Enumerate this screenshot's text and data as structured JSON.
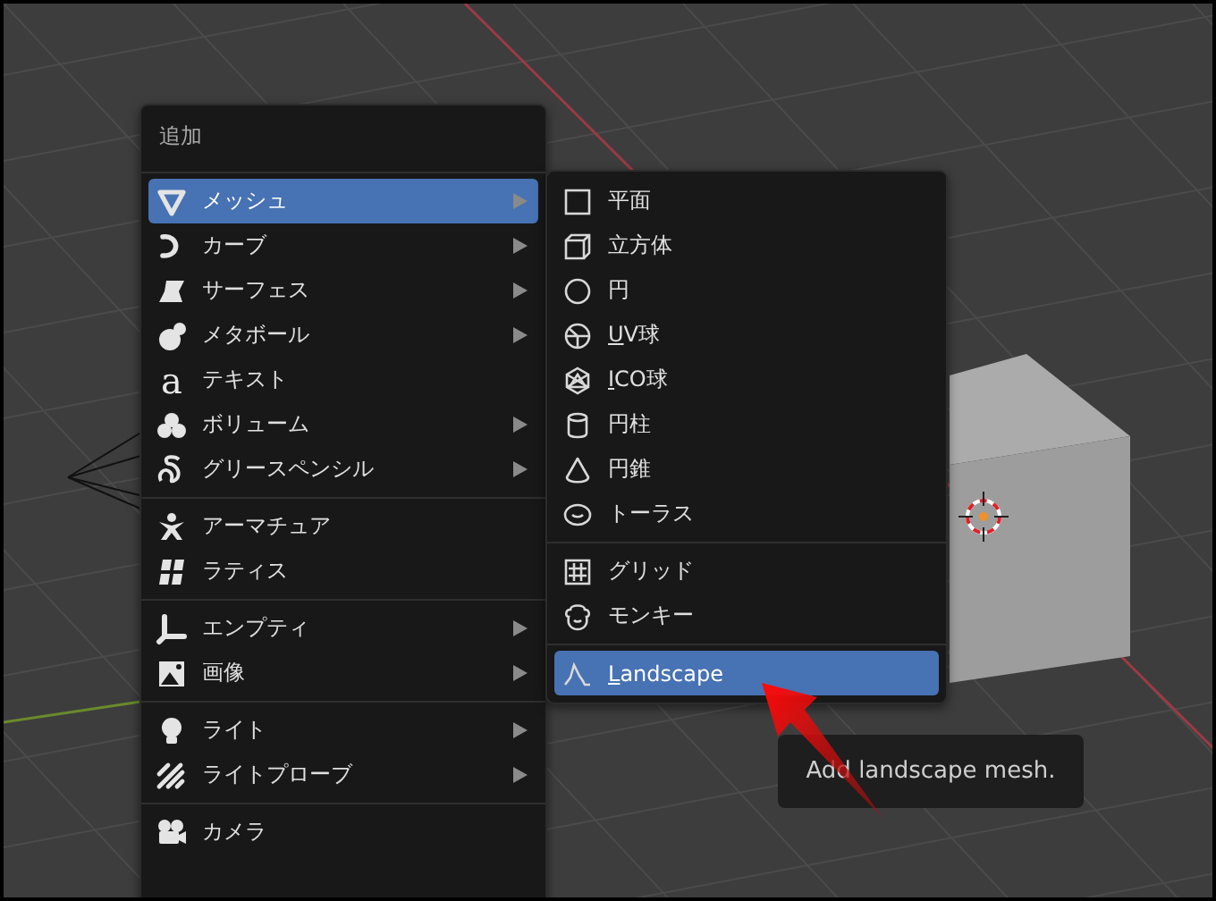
{
  "add_menu": {
    "title": "追加",
    "sections": [
      [
        {
          "label": "メッシュ",
          "selected": true,
          "has_submenu": true
        },
        {
          "label": "カーブ",
          "selected": false,
          "has_submenu": true
        },
        {
          "label": "サーフェス",
          "selected": false,
          "has_submenu": true
        },
        {
          "label": "メタボール",
          "selected": false,
          "has_submenu": true
        },
        {
          "label": "テキスト",
          "selected": false,
          "has_submenu": false,
          "glyph": "a"
        },
        {
          "label": "ボリューム",
          "selected": false,
          "has_submenu": true
        },
        {
          "label": "グリースペンシル",
          "selected": false,
          "has_submenu": true
        }
      ],
      [
        {
          "label": "アーマチュア",
          "selected": false,
          "has_submenu": false
        },
        {
          "label": "ラティス",
          "selected": false,
          "has_submenu": false
        }
      ],
      [
        {
          "label": "エンプティ",
          "selected": false,
          "has_submenu": true
        },
        {
          "label": "画像",
          "selected": false,
          "has_submenu": true
        }
      ],
      [
        {
          "label": "ライト",
          "selected": false,
          "has_submenu": true
        },
        {
          "label": "ライトプローブ",
          "selected": false,
          "has_submenu": true
        }
      ],
      [
        {
          "label": "カメラ",
          "selected": false,
          "has_submenu": false
        }
      ]
    ]
  },
  "mesh_submenu": {
    "sections": [
      [
        {
          "label": "平面",
          "selected": false,
          "mnemonic": false
        },
        {
          "label": "立方体",
          "selected": false,
          "mnemonic": false
        },
        {
          "label": "円",
          "selected": false,
          "mnemonic": false
        },
        {
          "label": "UV球",
          "selected": false,
          "mnemonic": true
        },
        {
          "label": "ICO球",
          "selected": false,
          "mnemonic": true
        },
        {
          "label": "円柱",
          "selected": false,
          "mnemonic": false
        },
        {
          "label": "円錐",
          "selected": false,
          "mnemonic": false
        },
        {
          "label": "トーラス",
          "selected": false,
          "mnemonic": false
        }
      ],
      [
        {
          "label": "グリッド",
          "selected": false,
          "mnemonic": false
        },
        {
          "label": "モンキー",
          "selected": false,
          "mnemonic": false
        }
      ],
      [
        {
          "label": "Landscape",
          "selected": true,
          "mnemonic": true
        }
      ]
    ]
  },
  "tooltip": {
    "text": "Add landscape mesh."
  }
}
